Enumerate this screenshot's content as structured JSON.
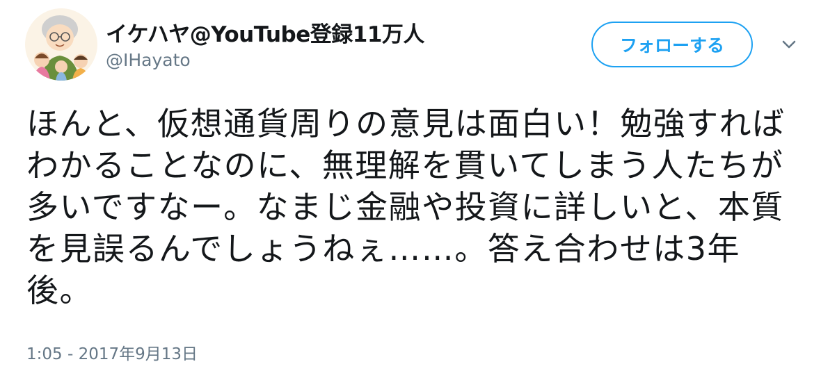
{
  "user": {
    "display_name": "イケハヤ@YouTube登録11万人",
    "handle": "@IHayato",
    "avatar_icon": "user-avatar-illustration"
  },
  "actions": {
    "follow_label": "フォローする",
    "menu_icon": "chevron-down-icon"
  },
  "tweet": {
    "text": "ほんと、仮想通貨周りの意見は面白い！勉強すればわかることなのに、無理解を貫いてしまう人たちが多いですなー。なまじ金融や投資に詳しいと、本質を見誤るんでしょうねぇ……。答え合わせは3年後。",
    "timestamp": "1:05 - 2017年9月13日"
  },
  "colors": {
    "accent": "#1da1f2",
    "secondary_text": "#657786",
    "primary_text": "#14171a"
  }
}
